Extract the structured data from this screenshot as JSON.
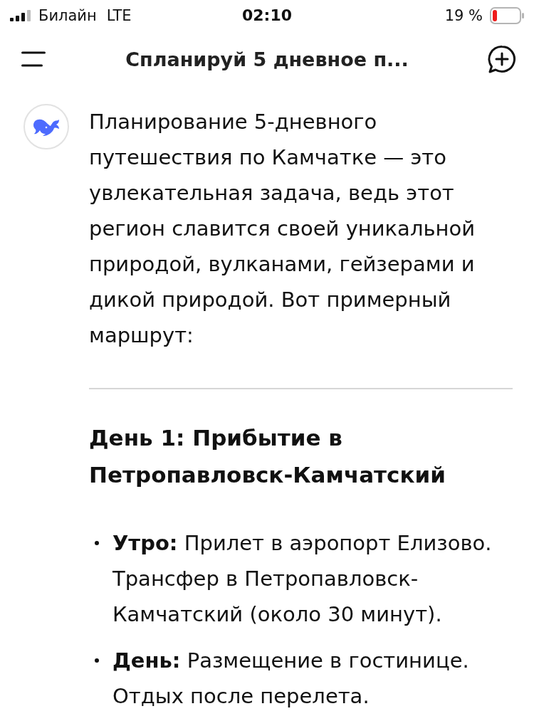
{
  "status_bar": {
    "carrier": "Билайн",
    "network": "LTE",
    "time": "02:10",
    "battery": "19 %"
  },
  "header": {
    "title": "Спланируй 5 дневное п..."
  },
  "message": {
    "intro": "Планирование 5-дневного путешествия по Камчатке — это увлекательная задача, ведь этот регион славится своей уникальной природой, вулканами, гейзерами и дикой природой. Вот примерный маршрут:",
    "sections": [
      {
        "heading": "День 1: Прибытие в Петропавловск-Камчатский",
        "items": [
          "**Утро:** Прилет в аэропорт Елизово. Трансфер в Петропавловск-Камчатский (около 30 минут).",
          "**День:** Размещение в гостинице. Отдых после перелета."
        ]
      }
    ]
  }
}
